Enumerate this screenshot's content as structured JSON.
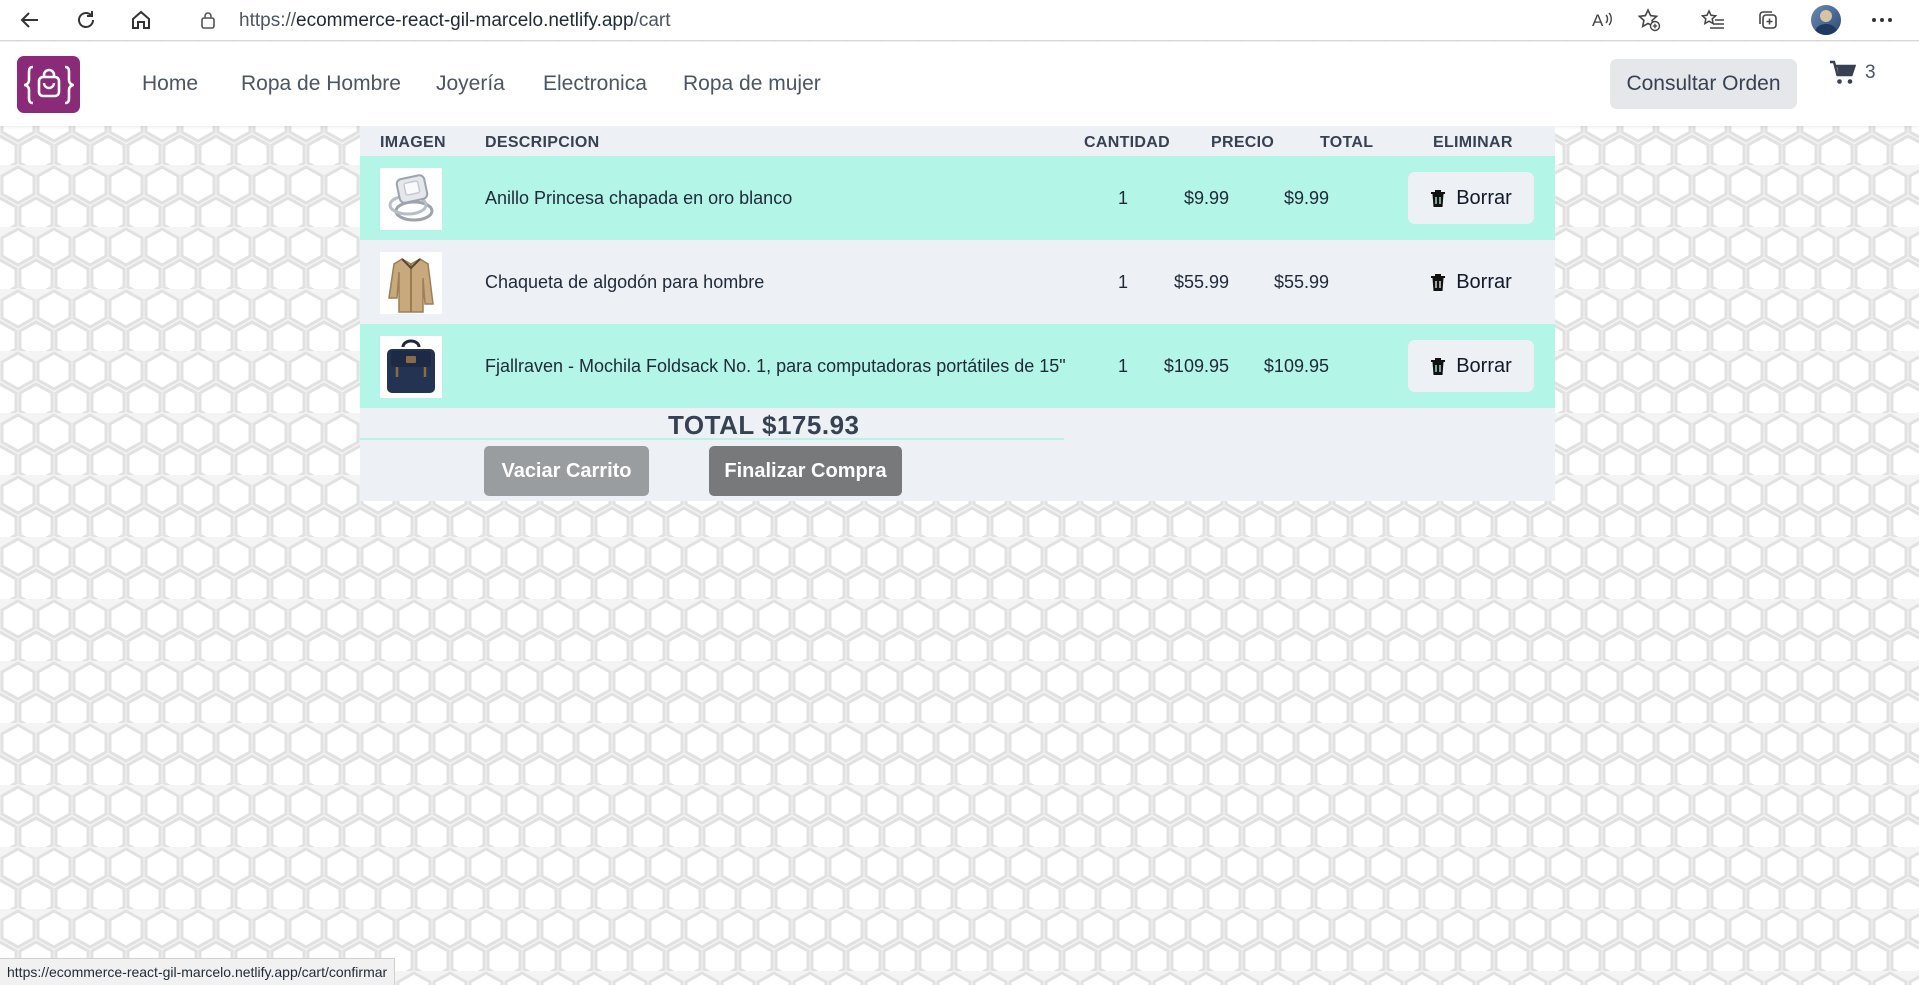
{
  "browser": {
    "url_scheme": "https://",
    "url_host": "ecommerce-react-gil-marcelo.netlify.app",
    "url_path": "/cart",
    "status_url": "https://ecommerce-react-gil-marcelo.netlify.app/cart/confirmar"
  },
  "header": {
    "nav": [
      "Home",
      "Ropa de Hombre",
      "Joyería",
      "Electronica",
      "Ropa de mujer"
    ],
    "order_button": "Consultar Orden",
    "cart_count": "3",
    "logo_color": "#8a2a78"
  },
  "cart": {
    "columns": {
      "image": "IMAGEN",
      "description": "DESCRIPCION",
      "quantity": "CANTIDAD",
      "price": "PRECIO",
      "total": "TOTAL",
      "remove": "ELIMINAR"
    },
    "items": [
      {
        "description": "Anillo Princesa chapada en oro blanco",
        "quantity": "1",
        "price": "$9.99",
        "total": "$9.99",
        "remove_label": "Borrar",
        "thumb": "ring-image"
      },
      {
        "description": "Chaqueta de algodón para hombre",
        "quantity": "1",
        "price": "$55.99",
        "total": "$55.99",
        "remove_label": "Borrar",
        "thumb": "jacket-image"
      },
      {
        "description": "Fjallraven - Mochila Foldsack No. 1, para computadoras portátiles de 15\"",
        "quantity": "1",
        "price": "$109.95",
        "total": "$109.95",
        "remove_label": "Borrar",
        "thumb": "backpack-image"
      }
    ],
    "total_label": "TOTAL $175.93",
    "clear_button": "Vaciar Carrito",
    "checkout_button": "Finalizar Compra",
    "highlight_color": "#b3f5e7"
  }
}
